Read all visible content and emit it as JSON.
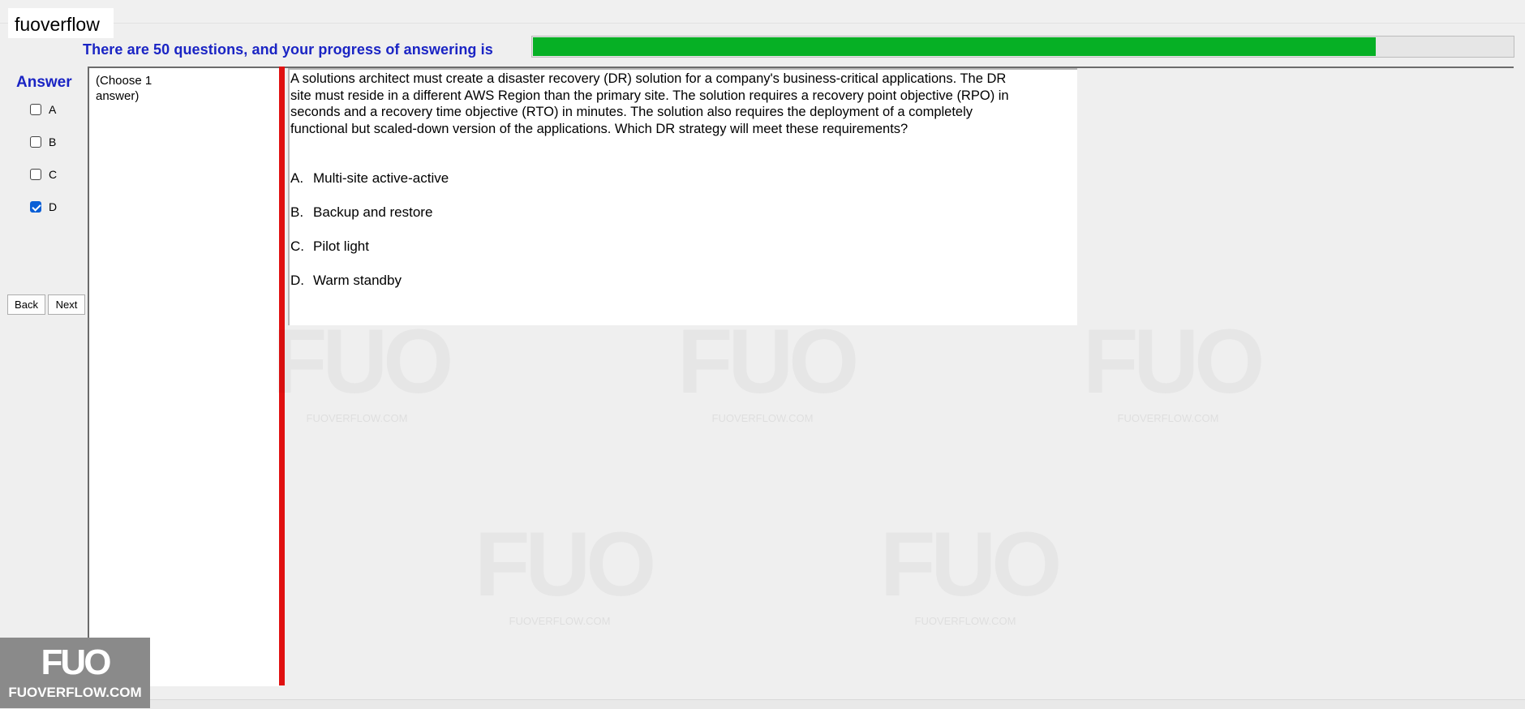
{
  "app": {
    "title": "fuoverflow"
  },
  "progress": {
    "label": "There are 50 questions, and your progress of answering is",
    "fraction": 0.86
  },
  "answer_panel": {
    "heading": "Answer",
    "options": [
      {
        "label": "A",
        "checked": false
      },
      {
        "label": "B",
        "checked": false
      },
      {
        "label": "C",
        "checked": false
      },
      {
        "label": "D",
        "checked": true
      }
    ],
    "back_label": "Back",
    "next_label": "Next"
  },
  "instruction": "(Choose 1\nanswer)",
  "question": {
    "text": "A solutions architect must create a disaster recovery (DR) solution for a company's business-critical applications. The DR site must reside in a different AWS Region than the primary site. The solution requires a recovery point objective (RPO) in seconds and a recovery time objective (RTO) in minutes. The solution also requires the deployment of a completely functional but scaled-down version of the applications. Which DR strategy will meet these requirements?",
    "choices": [
      {
        "letter": "A.",
        "text": "Multi-site active-active"
      },
      {
        "letter": "B.",
        "text": "Backup and restore"
      },
      {
        "letter": "C.",
        "text": "Pilot light"
      },
      {
        "letter": "D.",
        "text": "Warm standby"
      }
    ]
  },
  "watermark": {
    "logo": "FUO",
    "text": "FUOVERFLOW.COM"
  },
  "corner_logo": {
    "logo": "FUO",
    "text": "FUOVERFLOW.COM"
  },
  "colors": {
    "progress_fill": "#06b025",
    "heading_blue": "#1a24c4",
    "divider_red": "#e01010",
    "checkbox_checked": "#0a5fd6"
  }
}
